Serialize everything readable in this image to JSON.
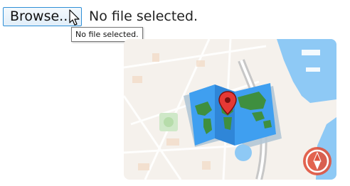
{
  "file_input": {
    "button_label": "Browse...",
    "status_text": "No file selected.",
    "tooltip_text": "No file selected."
  },
  "preview": {
    "icon": "world-map-pin-icon",
    "compass_icon": "compass-icon",
    "colors": {
      "water": "#8ec9f5",
      "land_green": "#3f8f3f",
      "map_blue": "#3f9ff0",
      "pin_red": "#e53935",
      "compass_red": "#e0533e"
    }
  }
}
